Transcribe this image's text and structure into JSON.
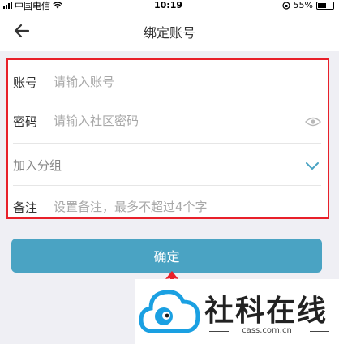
{
  "status_bar": {
    "carrier": "中国电信",
    "time": "10:19",
    "battery": "55%"
  },
  "header": {
    "title": "绑定账号"
  },
  "form": {
    "account_label": "账号",
    "account_placeholder": "请输入账号",
    "password_label": "密码",
    "password_placeholder": "请输入社区密码",
    "group_label": "加入分组",
    "remark_label": "备注",
    "remark_placeholder": "设置备注，最多不超过4个字"
  },
  "confirm_label": "确定",
  "watermark": {
    "title": "社科在线",
    "url": "cass.com.cn"
  },
  "colors": {
    "accent": "#4aa3c3",
    "highlight": "#e8202a"
  }
}
